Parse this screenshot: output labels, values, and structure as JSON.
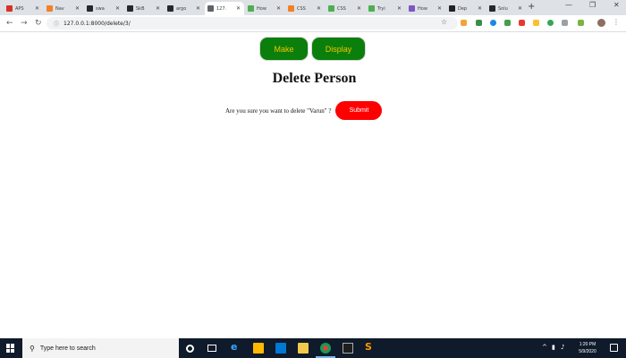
{
  "browser": {
    "tabs": [
      {
        "title": "APS",
        "icon": "gmail-icon",
        "color": "#d93025"
      },
      {
        "title": "Nav",
        "icon": "stackoverflow-icon",
        "color": "#f48024"
      },
      {
        "title": "swa",
        "icon": "github-icon",
        "color": "#24292e"
      },
      {
        "title": "SkB",
        "icon": "github-icon",
        "color": "#24292e"
      },
      {
        "title": "argo",
        "icon": "github-icon",
        "color": "#24292e"
      },
      {
        "title": "127.",
        "icon": "globe-icon",
        "color": "#5f6368"
      },
      {
        "title": "How",
        "icon": "w3schools-icon",
        "color": "#4caf50"
      },
      {
        "title": "CSS",
        "icon": "stackoverflow-icon",
        "color": "#f48024"
      },
      {
        "title": "CSS",
        "icon": "w3schools-icon",
        "color": "#4caf50"
      },
      {
        "title": "Tryi",
        "icon": "w3schools-icon",
        "color": "#4caf50"
      },
      {
        "title": "How",
        "icon": "stackoverflow-icon",
        "color": "#7e57c2"
      },
      {
        "title": "Dep",
        "icon": "book-icon",
        "color": "#202124"
      },
      {
        "title": "Solu",
        "icon": "github-icon",
        "color": "#24292e"
      }
    ],
    "active_tab": 5,
    "url": "127.0.0.1:8000/delete/3/"
  },
  "page": {
    "nav": {
      "make_label": "Make",
      "display_label": "Display"
    },
    "title": "Delete Person",
    "confirm_text": "Are you sure you want to delete \"Varun\" ?",
    "submit_label": "Submit"
  },
  "taskbar": {
    "search_placeholder": "Type here to search",
    "time": "1:20 PM",
    "date": "5/9/2020"
  },
  "colors": {
    "card": "#008080",
    "card_shadow": "#c21818",
    "nav_button": "#0b7f0b",
    "nav_text": "#f3c300",
    "submit": "#ff0000"
  }
}
